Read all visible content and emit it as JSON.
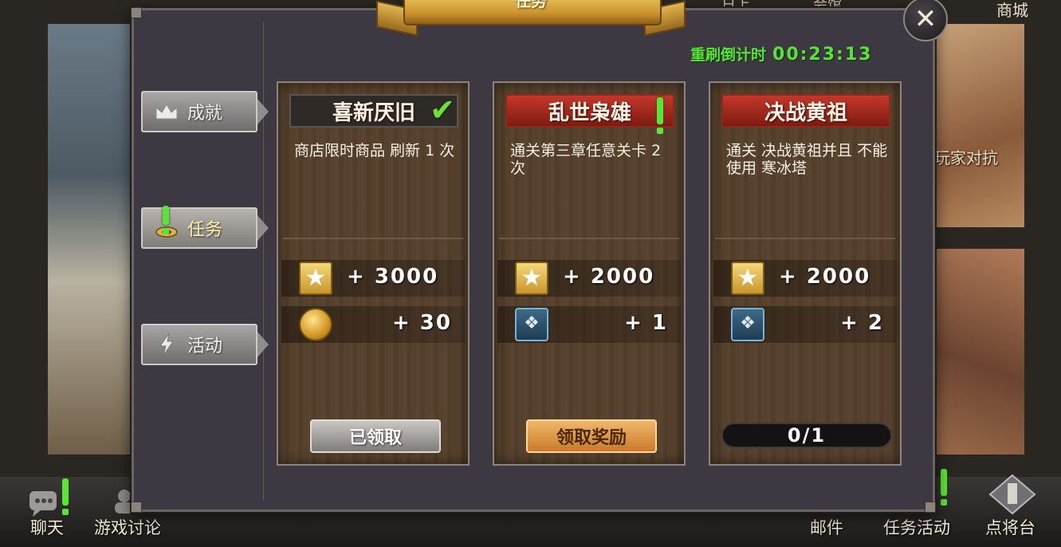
{
  "background": {
    "top_menu": [
      "日上",
      "会馆",
      "商城"
    ],
    "right_panel_label": "玩家对抗"
  },
  "bottom_bar": {
    "left": [
      {
        "label": "聊天",
        "icon": "chat-icon",
        "alert": true
      },
      {
        "label": "游戏讨论",
        "icon": "discussion-icon",
        "alert": false
      }
    ],
    "right": [
      {
        "label": "邮件",
        "icon": "mail-icon",
        "alert": false
      },
      {
        "label": "任务活动",
        "icon": "task-activity-icon",
        "alert": true
      },
      {
        "label": "点将台",
        "icon": "general-platform-icon",
        "alert": false
      }
    ]
  },
  "dialog": {
    "title": "任务",
    "close_icon": "close-icon",
    "refresh_timer": {
      "label": "重刷倒计时",
      "value": "00:23:13"
    },
    "tabs": [
      {
        "label": "成就",
        "icon": "crown-icon",
        "active": false
      },
      {
        "label": "任务",
        "icon": "task-scroll-icon",
        "active": true,
        "alert": true
      },
      {
        "label": "活动",
        "icon": "lightning-icon",
        "active": false
      }
    ],
    "cards": [
      {
        "title": "喜新厌旧",
        "title_state": "completed",
        "description": "商店限时商品 刷新 1 次",
        "rewards": [
          {
            "icon": "star-icon",
            "amount": "+ 3000"
          },
          {
            "icon": "gold-coin-icon",
            "amount": "+ 30"
          }
        ],
        "action": "已领取",
        "action_style": "claimed"
      },
      {
        "title": "乱世枭雄",
        "title_state": "claimable",
        "description": "通关第三章任意关卡 2 次",
        "rewards": [
          {
            "icon": "star-icon",
            "amount": "+ 2000"
          },
          {
            "icon": "general-card-icon",
            "amount": "+ 1"
          }
        ],
        "action": "领取奖励",
        "action_style": "claim"
      },
      {
        "title": "决战黄祖",
        "title_state": "in-progress",
        "description": "通关 决战黄祖并且 不能使用 寒冰塔",
        "rewards": [
          {
            "icon": "star-icon",
            "amount": "+ 2000"
          },
          {
            "icon": "general-card-icon",
            "amount": "+ 2"
          }
        ],
        "progress": {
          "text": "0/1",
          "current": 0,
          "total": 1
        }
      }
    ]
  },
  "colors": {
    "timer_green": "#58e23a",
    "alert_green": "#5fe03a",
    "title_red": "#c4372a",
    "claim_gold": "#f2b76a"
  }
}
